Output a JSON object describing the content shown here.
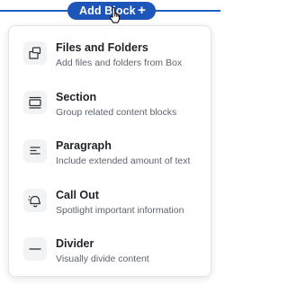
{
  "add_block": {
    "label": "Add Block",
    "plus": "+"
  },
  "menu": {
    "items": [
      {
        "title": "Files and Folders",
        "description": "Add files and folders from Box",
        "icon": "files-folders-icon"
      },
      {
        "title": "Section",
        "description": "Group related content blocks",
        "icon": "section-icon"
      },
      {
        "title": "Paragraph",
        "description": "Include extended amount of text",
        "icon": "paragraph-icon"
      },
      {
        "title": "Call Out",
        "description": "Spotlight important information",
        "icon": "callout-icon"
      },
      {
        "title": "Divider",
        "description": "Visually divide content",
        "icon": "divider-icon"
      }
    ]
  },
  "colors": {
    "accent": "#1d56b8",
    "title_text": "#1f2328",
    "desc_text": "#5d6470",
    "icon_bg": "#f1f3f5"
  }
}
